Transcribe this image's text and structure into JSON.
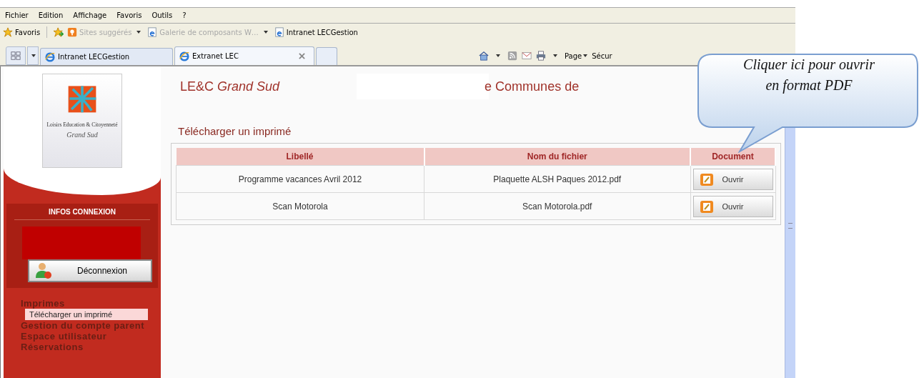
{
  "menu_bar": [
    "Fichier",
    "Edition",
    "Affichage",
    "Favoris",
    "Outils",
    "?"
  ],
  "favorites_bar": {
    "favorites_label": "Favoris",
    "links": [
      {
        "label": "Sites suggérés",
        "kind": "suggest",
        "dropdown": true,
        "disabled": true
      },
      {
        "label": "Galerie de composants W…",
        "kind": "page",
        "dropdown": true,
        "disabled": true
      },
      {
        "label": "Intranet LECGestion",
        "kind": "page",
        "dropdown": false,
        "disabled": false
      }
    ]
  },
  "tabs": [
    {
      "label": "Intranet LECGestion",
      "selected": false,
      "closable": false
    },
    {
      "label": "Extranet LEC",
      "selected": true,
      "closable": true
    }
  ],
  "command_bar": {
    "page_label": "Page",
    "security_label": "Sécur"
  },
  "sidebar": {
    "logo": {
      "line1": "Loisirs Education & Citoyenneté",
      "line2": "Grand Sud"
    },
    "info_title": "INFOS CONNEXION",
    "logout_button": "Déconnexion",
    "nav": [
      {
        "label": "Imprimes",
        "selected": false,
        "children": [
          {
            "label": "Télécharger un imprimé",
            "selected": true
          }
        ]
      },
      {
        "label": "Gestion du compte parent",
        "selected": false
      },
      {
        "label": "Espace utilisateur",
        "selected": false
      },
      {
        "label": "Réservations",
        "selected": false
      }
    ]
  },
  "header": {
    "site_title": "LE&C *Grand Sud*",
    "title_tail": "e Communes de"
  },
  "page_title": "Télécharger un imprimé",
  "table": {
    "columns": [
      "Libellé",
      "Nom du fichier",
      "Document"
    ],
    "rows": [
      {
        "label": "Programme vacances Avril 2012",
        "file": "Plaquette ALSH Paques 2012.pdf",
        "button": "Ouvrir"
      },
      {
        "label": "Scan Motorola",
        "file": "Scan Motorola.pdf",
        "button": "Ouvrir"
      }
    ]
  },
  "callout": {
    "line1": "Cliquer ici pour ouvrir",
    "line2": "en format PDF"
  }
}
